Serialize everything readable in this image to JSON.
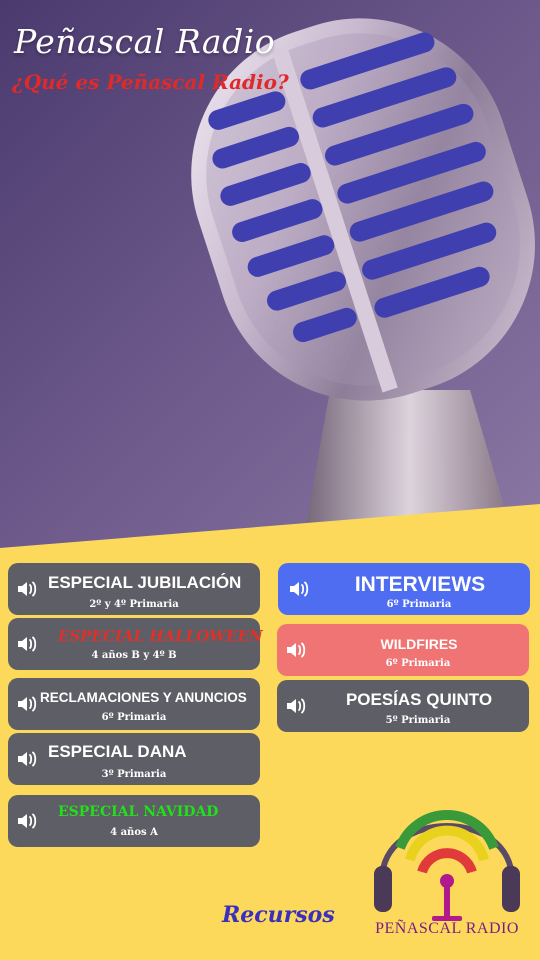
{
  "header": {
    "title": "Peñascal Radio",
    "subtitle": "¿Qué es Peñascal Radio?"
  },
  "colors": {
    "background": "#fcd95a",
    "button_gray": "#5e5e66",
    "button_blue": "#4f6df0",
    "button_red": "#f07474",
    "halloween_text": "#e0302a",
    "navidad_text": "#22e01a",
    "link": "#3b2fbf",
    "logo_text": "#7a1c8a"
  },
  "left_buttons": [
    {
      "label": "ESPECIAL JUBILACIÓN",
      "grade": "2º y 4º Primaria",
      "icon": "speaker-icon"
    },
    {
      "label": "ESPECIAL HALLOWEEN",
      "grade": "4 años B y 4º B",
      "icon": "speaker-icon"
    },
    {
      "label": "RECLAMACIONES Y ANUNCIOS",
      "grade": "6º Primaria",
      "icon": "speaker-icon"
    },
    {
      "label": "ESPECIAL DANA",
      "grade": "3º Primaria",
      "icon": "speaker-icon"
    },
    {
      "label": "ESPECIAL NAVIDAD",
      "grade": "4 años A",
      "icon": "speaker-icon"
    }
  ],
  "right_buttons": [
    {
      "label": "INTERVIEWS",
      "grade": "6º Primaria",
      "icon": "speaker-icon"
    },
    {
      "label": "WILDFIRES",
      "grade": "6º Primaria",
      "icon": "speaker-icon"
    },
    {
      "label": "POESÍAS QUINTO",
      "grade": "5º Primaria",
      "icon": "speaker-icon"
    }
  ],
  "footer": {
    "resources_link": "Recursos",
    "logo_text": "PEÑASCAL RADIO"
  }
}
